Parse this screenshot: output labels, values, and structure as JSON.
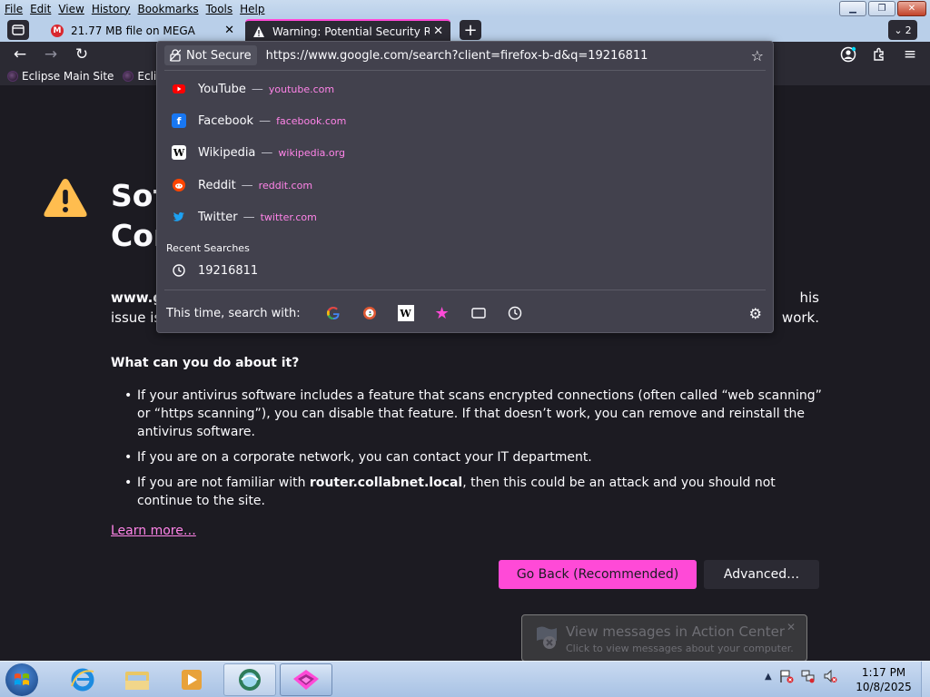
{
  "menu": [
    "File",
    "Edit",
    "View",
    "History",
    "Bookmarks",
    "Tools",
    "Help"
  ],
  "tabs": [
    {
      "title": "21.77 MB file on MEGA",
      "icon": "mega-icon"
    },
    {
      "title": "Warning: Potential Security Risk",
      "icon": "warning-icon"
    }
  ],
  "tab_count": "2",
  "bookmarks": [
    "Eclipse Main Site",
    "Eclips"
  ],
  "urlbar": {
    "security_label": "Not Secure",
    "url": "https://www.google.com/search?client=firefox-b-d&q=19216811"
  },
  "suggestions": [
    {
      "name": "YouTube",
      "dash": "—",
      "domain": "youtube.com",
      "icon": "youtube-icon",
      "color": "#ff0000"
    },
    {
      "name": "Facebook",
      "dash": "—",
      "domain": "facebook.com",
      "icon": "facebook-icon",
      "color": "#1877f2"
    },
    {
      "name": "Wikipedia",
      "dash": "—",
      "domain": "wikipedia.org",
      "icon": "wikipedia-icon",
      "color": "#ffffff"
    },
    {
      "name": "Reddit",
      "dash": "—",
      "domain": "reddit.com",
      "icon": "reddit-icon",
      "color": "#ff4500"
    },
    {
      "name": "Twitter",
      "dash": "—",
      "domain": "twitter.com",
      "icon": "twitter-icon",
      "color": "#1da1f2"
    }
  ],
  "recent": {
    "heading": "Recent Searches",
    "items": [
      "19216811"
    ]
  },
  "search_with": "This time, search with:",
  "search_engines": [
    "google-icon",
    "duckduckgo-icon",
    "wikipedia-icon",
    "bookmarks-star-icon",
    "tabs-icon",
    "history-icon"
  ],
  "error_page": {
    "title_visible": [
      "Sof",
      "Cor"
    ],
    "desc_left_1": "www.g",
    "desc_right_1": "his",
    "desc_left_2": "issue is",
    "desc_right_2": "work.",
    "what_heading": "What can you do about it?",
    "advice": [
      "If your antivirus software includes a feature that scans encrypted connections (often called “web scanning” or “https scanning”), you can disable that feature. If that doesn’t work, you can remove and reinstall the antivirus software.",
      "If you are on a corporate network, you can contact your IT department."
    ],
    "advice3_pre": "If you are not familiar with ",
    "advice3_host": "router.collabnet.local",
    "advice3_post": ", then this could be an attack and you should not continue to the site.",
    "learn_more": "Learn more…",
    "go_back": "Go Back (Recommended)",
    "advanced": "Advanced…"
  },
  "action_center": {
    "title": "View messages in Action Center",
    "subtitle": "Click to view messages about your computer."
  },
  "clock": {
    "time": "1:17 PM",
    "date": "10/8/2025"
  },
  "colors": {
    "accent": "#ff4ad7",
    "page_bg": "#1c1b22",
    "toolbar_bg": "#2b2a33",
    "panel_bg": "#42414d"
  }
}
